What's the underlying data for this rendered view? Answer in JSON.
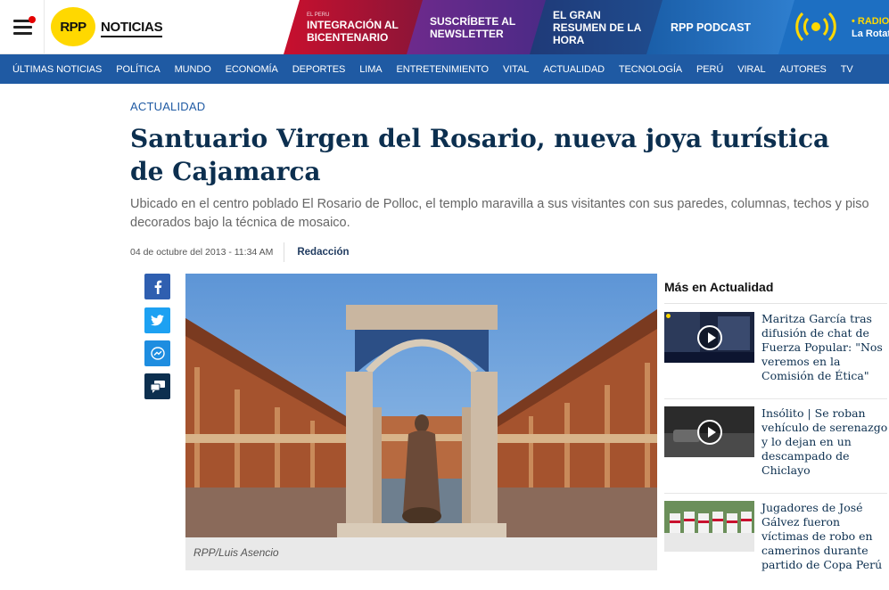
{
  "header": {
    "logo": "RPP",
    "brand": "NOTICIAS",
    "promos": [
      {
        "small": "EL PERÚ",
        "label": "INTEGRACIÓN AL BICENTENARIO"
      },
      {
        "label": "SUSCRÍBETE AL NEWSLETTER"
      },
      {
        "label": "EL GRAN RESUMEN DE LA HORA"
      },
      {
        "label": "RPP PODCAST"
      }
    ],
    "radio": {
      "line1": "• RADIO",
      "line2": "La Rotat"
    }
  },
  "nav": [
    "ÚLTIMAS NOTICIAS",
    "POLÍTICA",
    "MUNDO",
    "ECONOMÍA",
    "DEPORTES",
    "LIMA",
    "ENTRETENIMIENTO",
    "VITAL",
    "ACTUALIDAD",
    "TECNOLOGÍA",
    "PERÚ",
    "VIRAL",
    "AUTORES",
    "TV"
  ],
  "article": {
    "section": "ACTUALIDAD",
    "title": "Santuario Virgen del Rosario, nueva joya turística de Cajamarca",
    "subtitle": "Ubicado en el centro poblado El Rosario de Polloc, el templo maravilla a sus visitantes con sus paredes, columnas, techos y piso decorados bajo la técnica de mosaico.",
    "date": "04 de octubre del 2013 - 11:34 AM",
    "author": "Redacción",
    "photo_caption": "RPP/Luis Asencio"
  },
  "share": [
    "facebook-icon",
    "twitter-icon",
    "messenger-icon",
    "comments-icon"
  ],
  "sidebar": {
    "heading": "Más en Actualidad",
    "items": [
      {
        "text": "Maritza García tras difusión de chat de Fuerza Popular: \"Nos veremos en la Comisión de Ética\""
      },
      {
        "text": "Insólito | Se roban vehículo de serenazgo y lo dejan en un descampado de Chiclayo"
      },
      {
        "text": "Jugadores de José Gálvez fueron víctimas de robo en camerinos durante partido de Copa Perú"
      }
    ]
  },
  "colors": {
    "nav": "#1f5aa3",
    "title": "#0c2f4f",
    "logo": "#ffd800"
  }
}
